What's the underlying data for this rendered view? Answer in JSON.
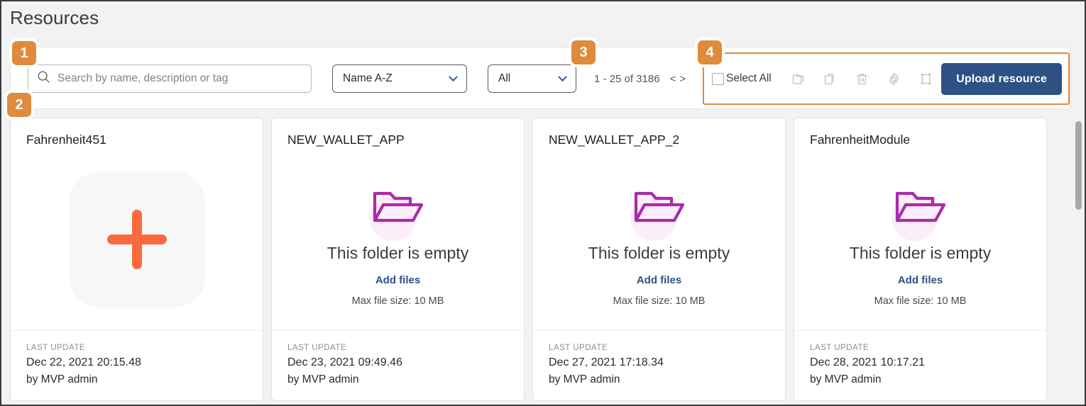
{
  "page": {
    "title": "Resources"
  },
  "toolbar": {
    "search": {
      "placeholder": "Search by name, description or tag",
      "value": "",
      "icon": "search-icon"
    },
    "sort_select": {
      "value": "Name A-Z",
      "icon": "chevron-down-icon"
    },
    "filter_select": {
      "value": "All",
      "icon": "chevron-down-icon"
    },
    "pagination": {
      "range_text": "1 - 25 of 3186",
      "prev_label": "<",
      "next_label": ">"
    },
    "actions": {
      "select_all_label": "Select All",
      "select_all_checked": false,
      "icons": [
        {
          "name": "move-to-folder-icon",
          "title": "Move to folder"
        },
        {
          "name": "copy-icon",
          "title": "Copy"
        },
        {
          "name": "trash-icon",
          "title": "Delete"
        },
        {
          "name": "gear-icon",
          "title": "Settings"
        },
        {
          "name": "transform-icon",
          "title": "Resize"
        }
      ],
      "upload_label": "Upload resource"
    }
  },
  "cards": [
    {
      "title": "Fahrenheit451",
      "type": "image",
      "thumbnail_icon": "plus-icon",
      "meta_label": "LAST UPDATE",
      "meta_date": "Dec 22, 2021 20:15.48",
      "meta_author": "by MVP admin"
    },
    {
      "title": "NEW_WALLET_APP",
      "type": "folder",
      "folder_icon": "open-folder-icon",
      "empty_text": "This folder is empty",
      "add_files_label": "Add files",
      "max_size_text": "Max file size: 10 MB",
      "meta_label": "LAST UPDATE",
      "meta_date": "Dec 23, 2021 09:49.46",
      "meta_author": "by MVP admin"
    },
    {
      "title": "NEW_WALLET_APP_2",
      "type": "folder",
      "folder_icon": "open-folder-icon",
      "empty_text": "This folder is empty",
      "add_files_label": "Add files",
      "max_size_text": "Max file size: 10 MB",
      "meta_label": "LAST UPDATE",
      "meta_date": "Dec 27, 2021 17:18.34",
      "meta_author": "by MVP admin"
    },
    {
      "title": "FahrenheitModule",
      "type": "folder",
      "folder_icon": "open-folder-icon",
      "empty_text": "This folder is empty",
      "add_files_label": "Add files",
      "max_size_text": "Max file size: 10 MB",
      "meta_label": "LAST UPDATE",
      "meta_date": "Dec 28, 2021 10:17.21",
      "meta_author": "by MVP admin"
    }
  ],
  "badges": [
    {
      "label": "1"
    },
    {
      "label": "2"
    },
    {
      "label": "3"
    },
    {
      "label": "4"
    }
  ],
  "colors": {
    "accent_orange": "#e08a3c",
    "brand_blue": "#2d5183",
    "plus_orange": "#fa6a3c",
    "folder_purple": "#a92bad",
    "page_bg": "#f2f2f2"
  }
}
